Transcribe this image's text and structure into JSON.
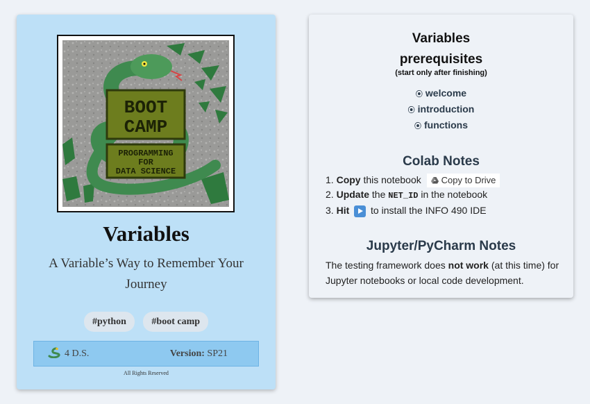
{
  "left_card": {
    "title": "Variables",
    "subtitle": "A Variable’s Way to Remember Your Journey",
    "tags": [
      "#python",
      "#boot camp"
    ],
    "org": "4 D.S.",
    "version_label": "Version:",
    "version_value": "SP21",
    "rights": "All Rights Reserved",
    "cover_text": {
      "boot": "BOOT",
      "camp": "CAMP",
      "prog1": "PROGRAMMING",
      "prog2": "FOR",
      "prog3": "DATA SCIENCE"
    }
  },
  "right_card": {
    "prereq_title_1": "Variables",
    "prereq_title_2": "prerequisites",
    "prereq_note": "(start only after finishing)",
    "prereqs": [
      "welcome",
      "introduction",
      "functions"
    ],
    "colab_title": "Colab Notes",
    "steps": {
      "s1_num": "1.",
      "s1_bold": "Copy",
      "s1_rest": "this notebook",
      "drive_button": "Copy to Drive",
      "s2_num": "2.",
      "s2_bold": "Update",
      "s2_pre": "the",
      "s2_code": "NET_ID",
      "s2_post": "in the notebook",
      "s3_num": "3.",
      "s3_bold": "Hit",
      "s3_rest": "to install the INFO 490 IDE"
    },
    "jupyter_title": "Jupyter/PyCharm Notes",
    "jupyter_pre": "The testing framework does",
    "jupyter_bold": "not work",
    "jupyter_post": "(at this time) for Jupyter notebooks or local code development."
  },
  "colors": {
    "left_card_bg": "#bde0f7",
    "footer_bar": "#8ec9f0",
    "page_bg": "#eef2f7",
    "snake_green": "#3f8a4f",
    "play_button": "#4a8fd6"
  }
}
